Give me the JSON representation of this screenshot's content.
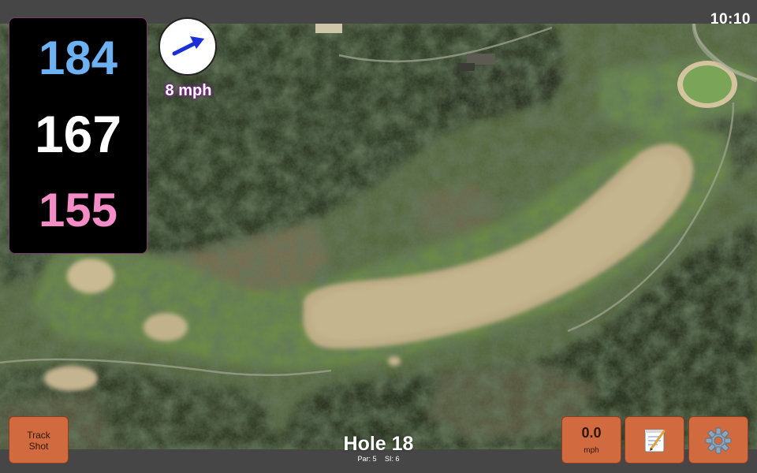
{
  "status": {
    "clock": "10:10"
  },
  "distances": {
    "back": "184",
    "center": "167",
    "front": "155"
  },
  "wind": {
    "speed": "8 mph",
    "direction_icon": "arrow-icon"
  },
  "hole": {
    "title": "Hole 18",
    "par": "Par: 5",
    "stroke_index": "SI: 6"
  },
  "buttons": {
    "track_shot_line1": "Track",
    "track_shot_line2": "Shot",
    "speed_value": "0.0",
    "speed_unit": "mph",
    "notes_icon": "notepad-icon",
    "settings_icon": "gear-icon"
  },
  "colors": {
    "back_distance": "#6cb2f2",
    "center_distance": "#ffffff",
    "front_distance": "#f48cc6",
    "button": "#d16b3f",
    "wind_arrow": "#1a2fd8"
  }
}
